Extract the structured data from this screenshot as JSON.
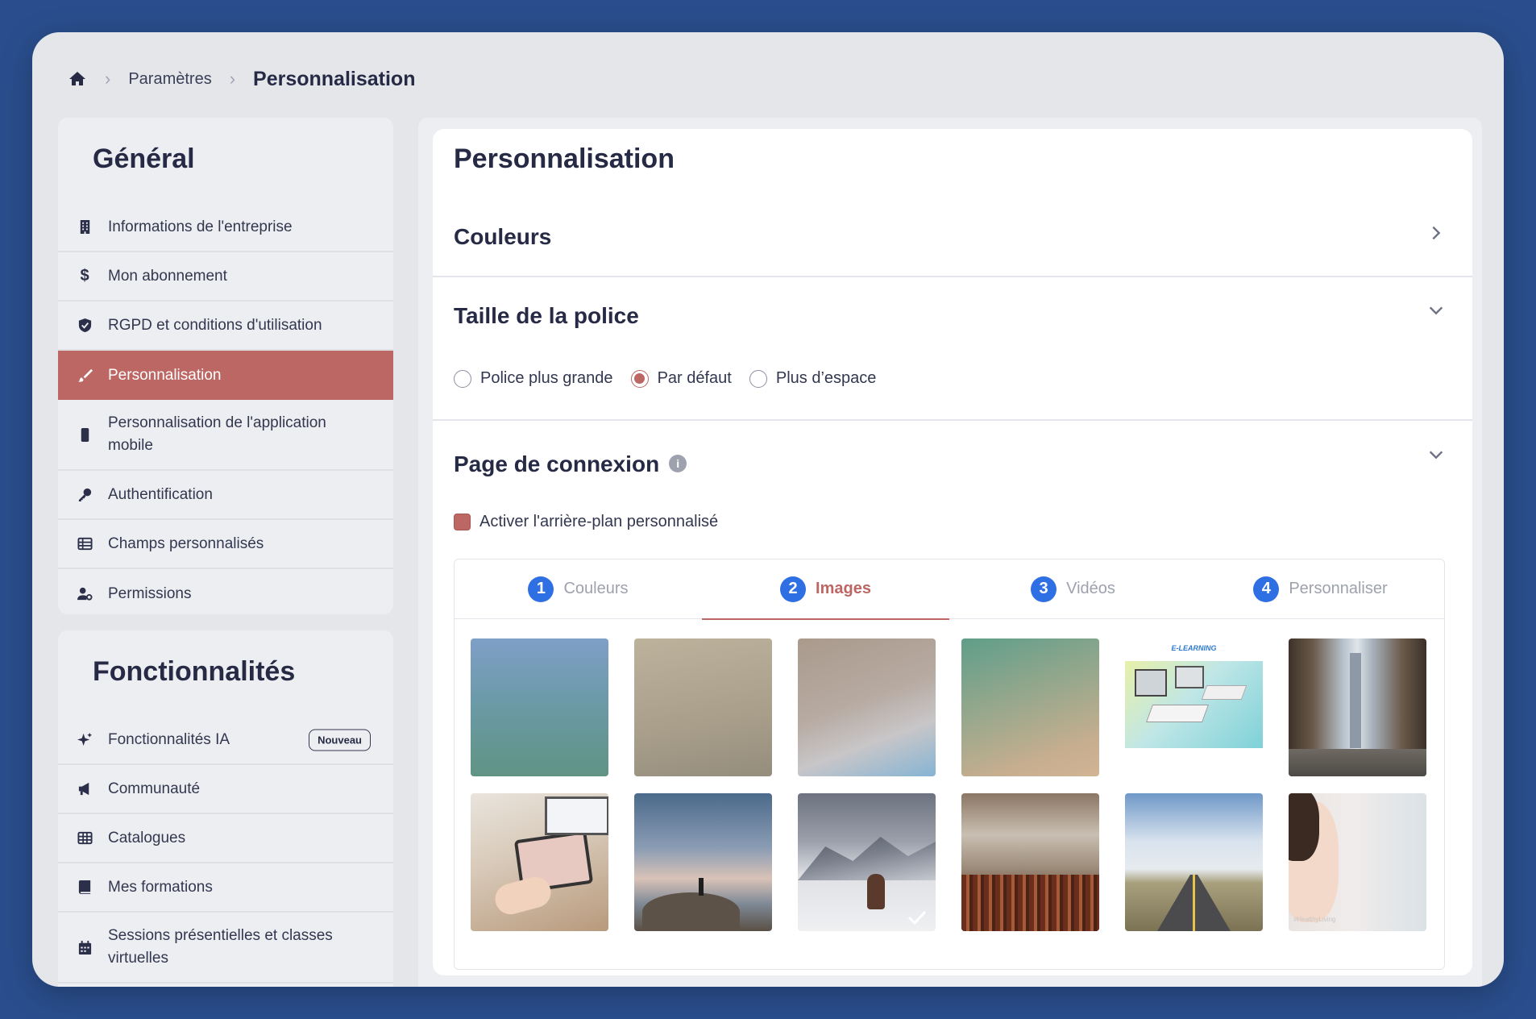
{
  "breadcrumb": {
    "home_icon": "home-icon",
    "parent": "Paramètres",
    "current": "Personnalisation"
  },
  "general": {
    "title": "Général",
    "items": [
      {
        "label": "Informations de l'entreprise",
        "icon": "building-icon"
      },
      {
        "label": "Mon abonnement",
        "icon": "dollar-icon"
      },
      {
        "label": "RGPD et conditions d'utilisation",
        "icon": "shield-icon"
      },
      {
        "label": "Personnalisation",
        "icon": "brush-icon",
        "active": true
      },
      {
        "label": "Personnalisation de l'application mobile",
        "icon": "mobile-icon"
      },
      {
        "label": "Authentification",
        "icon": "key-icon"
      },
      {
        "label": "Champs personnalisés",
        "icon": "table-icon"
      },
      {
        "label": "Permissions",
        "icon": "user-gear-icon"
      }
    ]
  },
  "features": {
    "title": "Fonctionnalités",
    "items": [
      {
        "label": "Fonctionnalités IA",
        "icon": "sparkles-icon",
        "badge": "Nouveau"
      },
      {
        "label": "Communauté",
        "icon": "megaphone-icon"
      },
      {
        "label": "Catalogues",
        "icon": "grid-icon"
      },
      {
        "label": "Mes formations",
        "icon": "book-icon"
      },
      {
        "label": "Sessions présentielles et classes virtuelles",
        "icon": "calendar-icon"
      }
    ]
  },
  "panel": {
    "title": "Personnalisation",
    "colors_section": "Couleurs",
    "font_section": "Taille de la police",
    "font_options": [
      "Police plus grande",
      "Par défaut",
      "Plus d’espace"
    ],
    "font_selected": "Par défaut",
    "login_section": "Page de connexion",
    "custom_bg_label": "Activer l'arrière-plan personnalisé",
    "custom_bg_checked": true,
    "tabs": [
      {
        "num": "1",
        "label": "Couleurs"
      },
      {
        "num": "2",
        "label": "Images",
        "active": true
      },
      {
        "num": "3",
        "label": "Vidéos"
      },
      {
        "num": "4",
        "label": "Personnaliser"
      }
    ],
    "thumb_text": {
      "elearning": "E-LEARNING",
      "hashtag": "#HealthyLiving"
    },
    "selected_image": "mountain-woman"
  },
  "colors": {
    "accent": "#bd6764",
    "tab_number": "#2f6fe4",
    "background": "#2a4e8d"
  }
}
